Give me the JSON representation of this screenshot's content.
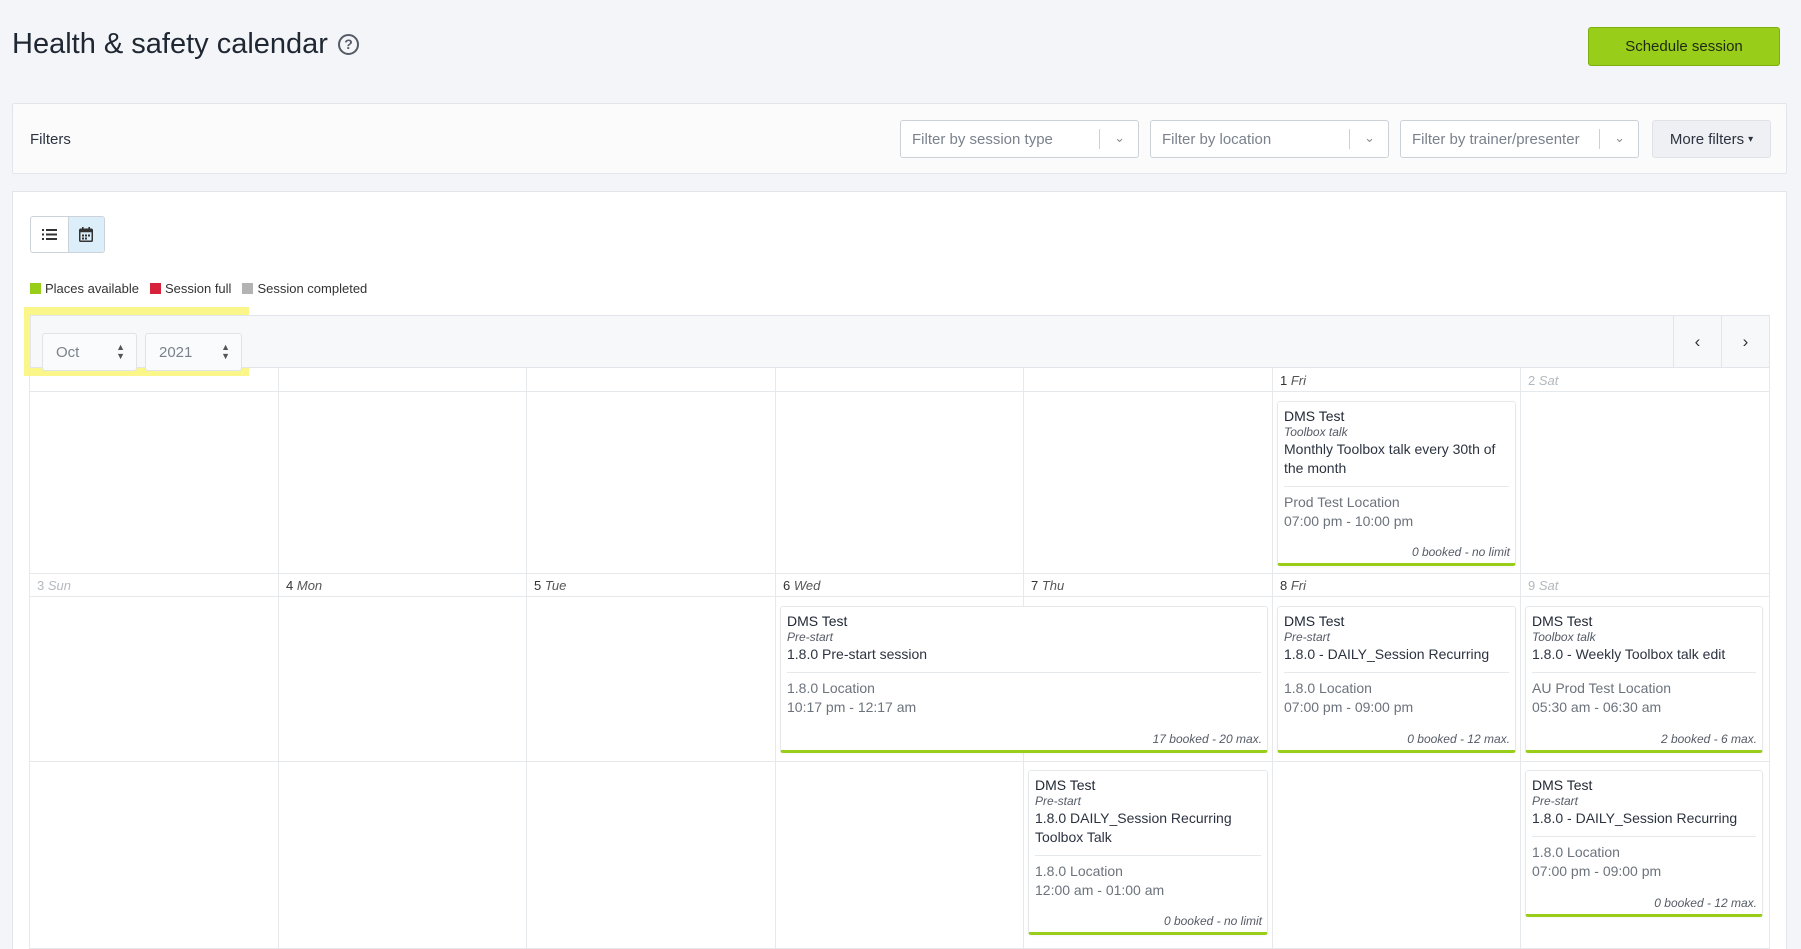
{
  "header": {
    "title": "Health & safety calendar",
    "help_icon": "question-circle-icon",
    "schedule_button": "Schedule session"
  },
  "filters": {
    "label": "Filters",
    "session_type_placeholder": "Filter by session type",
    "location_placeholder": "Filter by location",
    "trainer_placeholder": "Filter by trainer/presenter",
    "more_filters": "More filters"
  },
  "view": {
    "list_icon": "list-icon",
    "calendar_icon": "calendar-icon",
    "active": "calendar"
  },
  "legend": [
    {
      "label": "Places available",
      "color": "#98cd1a"
    },
    {
      "label": "Session full",
      "color": "#d6223a"
    },
    {
      "label": "Session completed",
      "color": "#b3b3b3"
    }
  ],
  "calendar": {
    "month": "Oct",
    "year": "2021",
    "prev_icon": "chevron-left-icon",
    "next_icon": "chevron-right-icon",
    "week1": [
      {
        "num": "",
        "dow": ""
      },
      {
        "num": "",
        "dow": ""
      },
      {
        "num": "",
        "dow": ""
      },
      {
        "num": "",
        "dow": ""
      },
      {
        "num": "",
        "dow": ""
      },
      {
        "num": "1",
        "dow": "Fri"
      },
      {
        "num": "2",
        "dow": "Sat"
      }
    ],
    "week2": [
      {
        "num": "3",
        "dow": "Sun"
      },
      {
        "num": "4",
        "dow": "Mon"
      },
      {
        "num": "5",
        "dow": "Tue"
      },
      {
        "num": "6",
        "dow": "Wed"
      },
      {
        "num": "7",
        "dow": "Thu"
      },
      {
        "num": "8",
        "dow": "Fri"
      },
      {
        "num": "9",
        "dow": "Sat"
      }
    ]
  },
  "events": [
    {
      "org": "DMS Test",
      "type": "Toolbox talk",
      "name": "Monthly Toolbox talk every 30th of the month",
      "location": "Prod Test Location",
      "time": "07:00 pm - 10:00 pm",
      "booked": "0 booked - no limit",
      "status_color": "#98cd1a"
    },
    {
      "org": "DMS Test",
      "type": "Pre-start",
      "name": "1.8.0 Pre-start session",
      "location": "1.8.0 Location",
      "time": "10:17 pm - 12:17 am",
      "booked": "17 booked - 20 max.",
      "status_color": "#98cd1a"
    },
    {
      "org": "DMS Test",
      "type": "Pre-start",
      "name": "1.8.0 - DAILY_Session Recurring",
      "location": "1.8.0 Location",
      "time": "07:00 pm - 09:00 pm",
      "booked": "0 booked - 12 max.",
      "status_color": "#98cd1a"
    },
    {
      "org": "DMS Test",
      "type": "Toolbox talk",
      "name": "1.8.0 - Weekly Toolbox talk edit",
      "location": "AU Prod Test Location",
      "time": "05:30 am - 06:30 am",
      "booked": "2 booked - 6 max.",
      "status_color": "#98cd1a"
    },
    {
      "org": "DMS Test",
      "type": "Pre-start",
      "name": "1.8.0 DAILY_Session Recurring Toolbox Talk",
      "location": "1.8.0 Location",
      "time": "12:00 am - 01:00 am",
      "booked": "0 booked - no limit",
      "status_color": "#98cd1a"
    },
    {
      "org": "DMS Test",
      "type": "Pre-start",
      "name": "1.8.0 - DAILY_Session Recurring",
      "location": "1.8.0 Location",
      "time": "07:00 pm - 09:00 pm",
      "booked": "0 booked - 12 max.",
      "status_color": "#98cd1a"
    }
  ]
}
